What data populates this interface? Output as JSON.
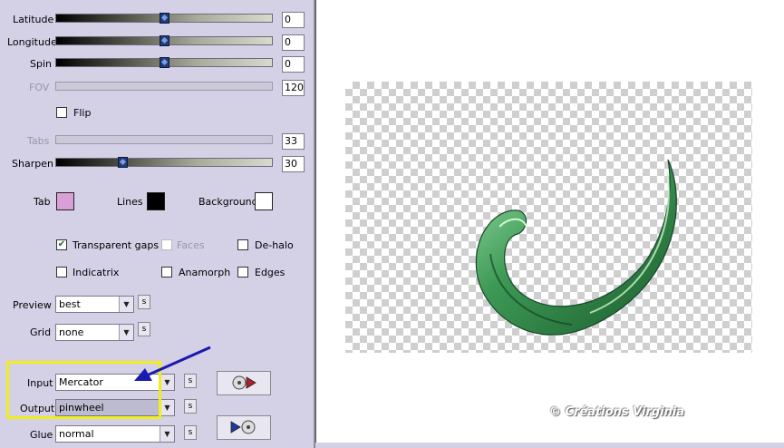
{
  "sliders": {
    "latitude": {
      "label": "Latitude",
      "value": "0"
    },
    "longitude": {
      "label": "Longitude",
      "value": "0"
    },
    "spin": {
      "label": "Spin",
      "value": "0"
    },
    "fov": {
      "label": "FOV",
      "value": "120"
    },
    "tabs": {
      "label": "Tabs",
      "value": "33"
    },
    "sharpen": {
      "label": "Sharpen",
      "value": "30"
    }
  },
  "flip": {
    "label": "Flip"
  },
  "colors": {
    "tab": {
      "label": "Tab",
      "color": "#d9a0d8"
    },
    "lines": {
      "label": "Lines",
      "color": "#000000"
    },
    "background": {
      "label": "Background",
      "color": "#ffffff"
    }
  },
  "options": {
    "transparent_gaps": {
      "label": "Transparent gaps",
      "checked": true
    },
    "faces": {
      "label": "Faces",
      "checked": false
    },
    "de_halo": {
      "label": "De-halo",
      "checked": false
    },
    "indicatrix": {
      "label": "Indicatrix",
      "checked": false
    },
    "anamorph": {
      "label": "Anamorph",
      "checked": false
    },
    "edges": {
      "label": "Edges",
      "checked": false
    }
  },
  "selects": {
    "preview": {
      "label": "Preview",
      "value": "best"
    },
    "grid": {
      "label": "Grid",
      "value": "none"
    },
    "input": {
      "label": "Input",
      "value": "Mercator"
    },
    "output": {
      "label": "Output",
      "value": "pinwheel"
    },
    "glue": {
      "label": "Glue",
      "value": "normal"
    }
  },
  "small_button_label": "s",
  "watermark": "© Créations Virginia",
  "accent": {
    "highlight": "#f2ee1a",
    "arrow": "#1a1ab0"
  }
}
